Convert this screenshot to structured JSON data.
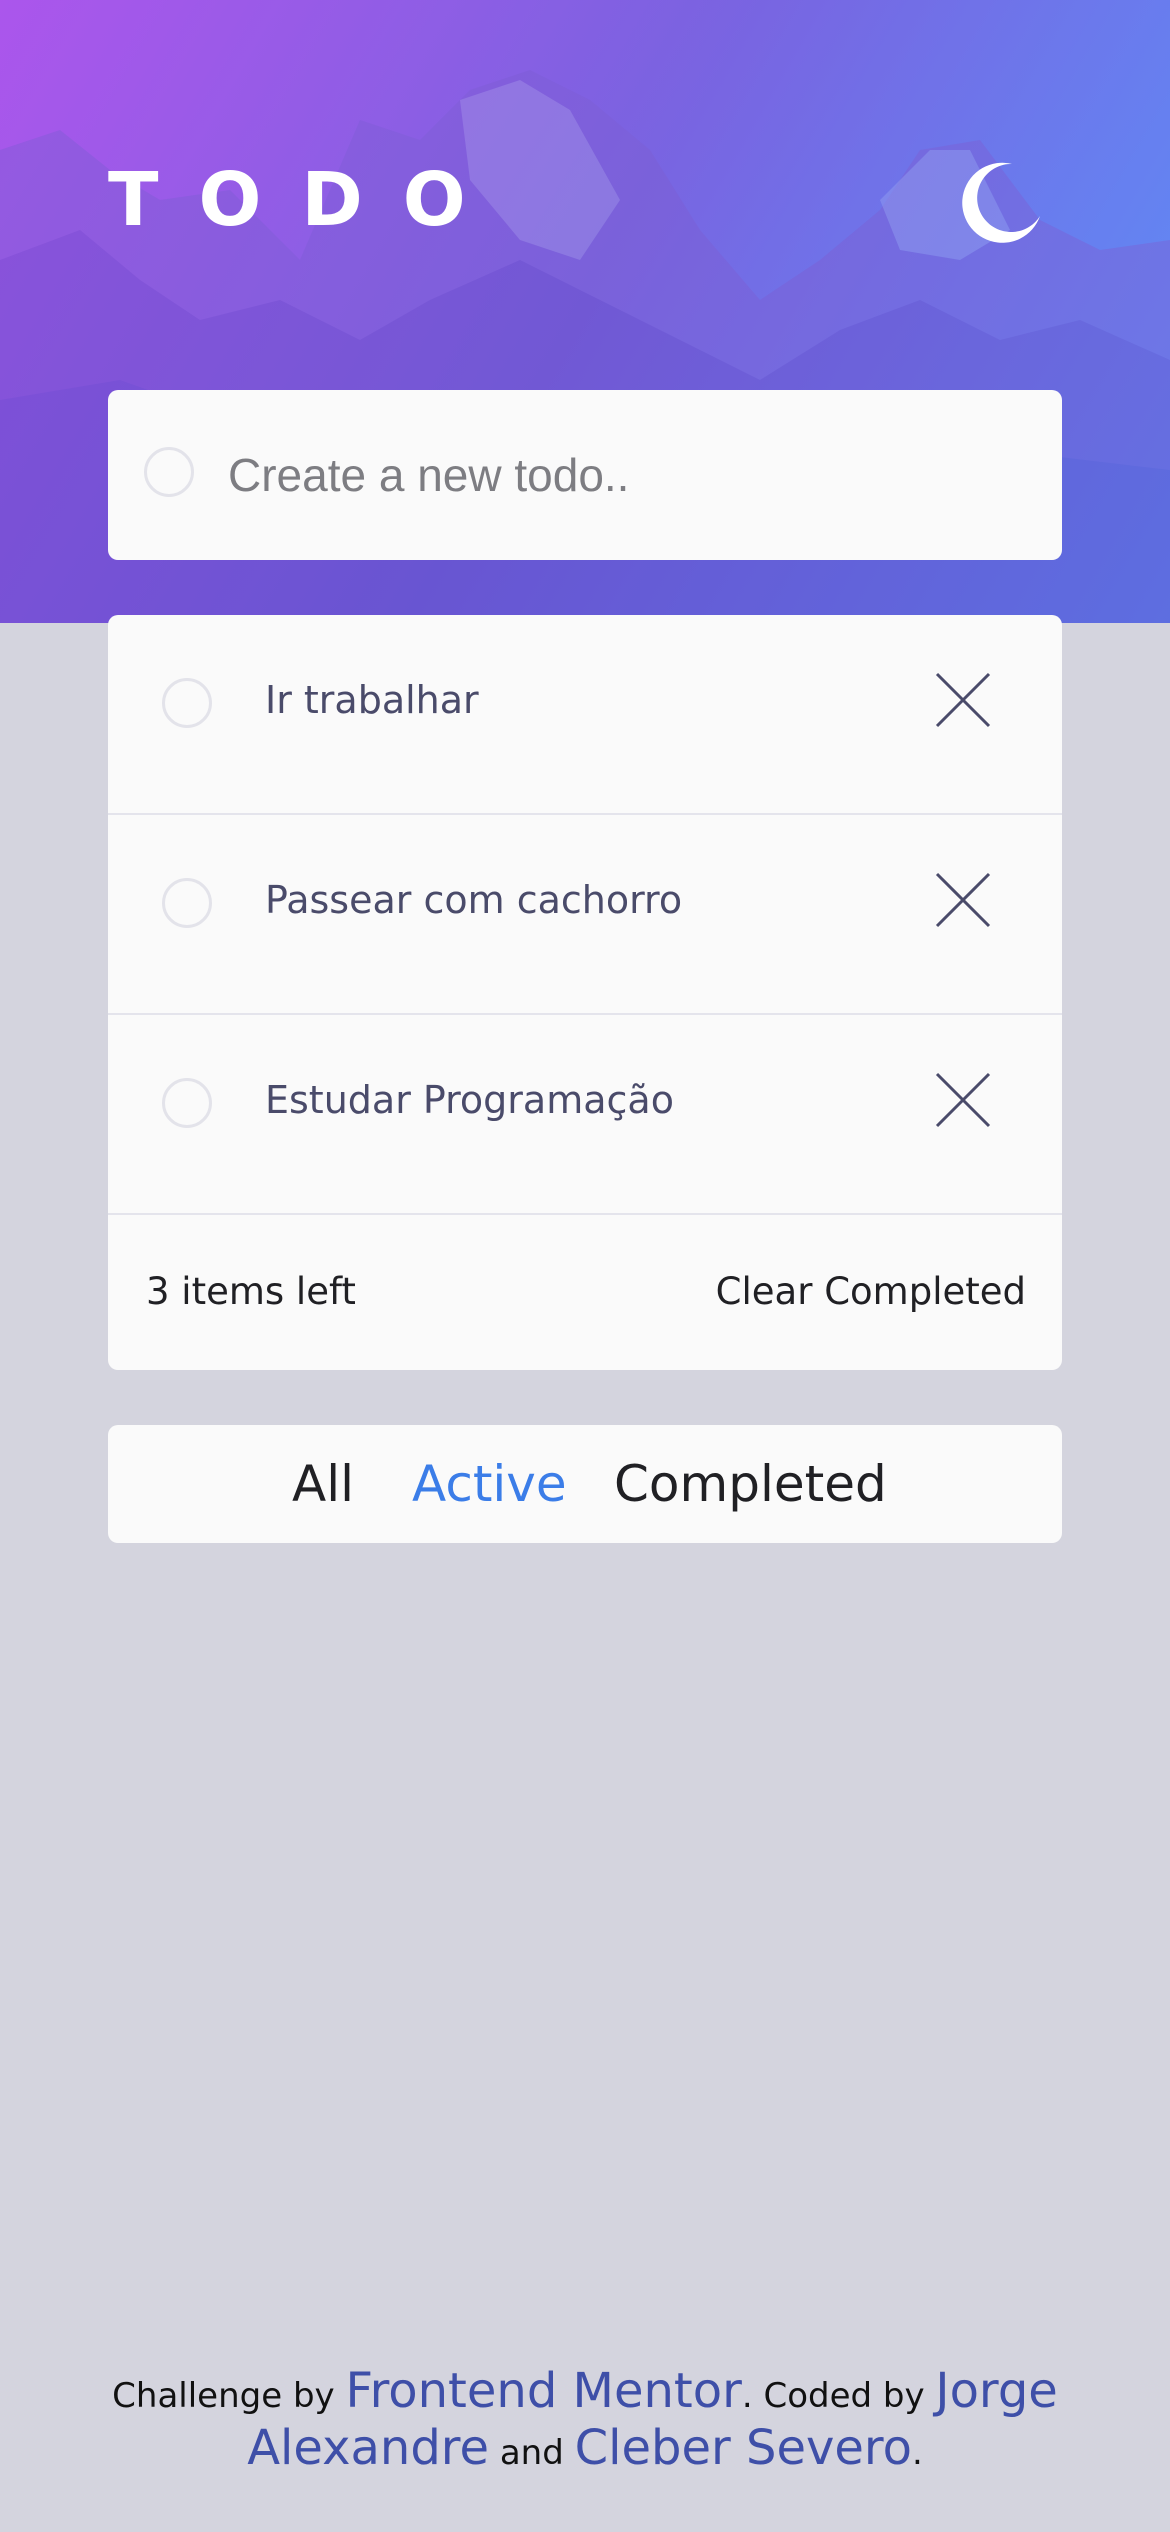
{
  "header": {
    "title": "TODO",
    "theme_icon": "moon-icon"
  },
  "new_todo": {
    "placeholder": "Create a new todo.."
  },
  "todos": [
    {
      "text": "Ir trabalhar",
      "completed": false
    },
    {
      "text": "Passear com cachorro",
      "completed": false
    },
    {
      "text": "Estudar Programação",
      "completed": false
    }
  ],
  "list_footer": {
    "items_left": "3 items left",
    "clear_completed": "Clear Completed"
  },
  "filters": {
    "all": "All",
    "active": "Active",
    "completed": "Completed",
    "selected": "Active"
  },
  "credits": {
    "challenge_by": "Challenge by",
    "frontend_mentor": "Frontend Mentor",
    "coded_by": ". Coded by",
    "author1": "Jorge Alexandre",
    "and": "and",
    "author2": "Cleber Severo",
    "end": "."
  },
  "colors": {
    "accent": "#3b7de8",
    "background": "#d4d4de",
    "card": "#fafafa",
    "todo_text": "#4a4b6a",
    "credit_link": "#3e4fa8"
  }
}
